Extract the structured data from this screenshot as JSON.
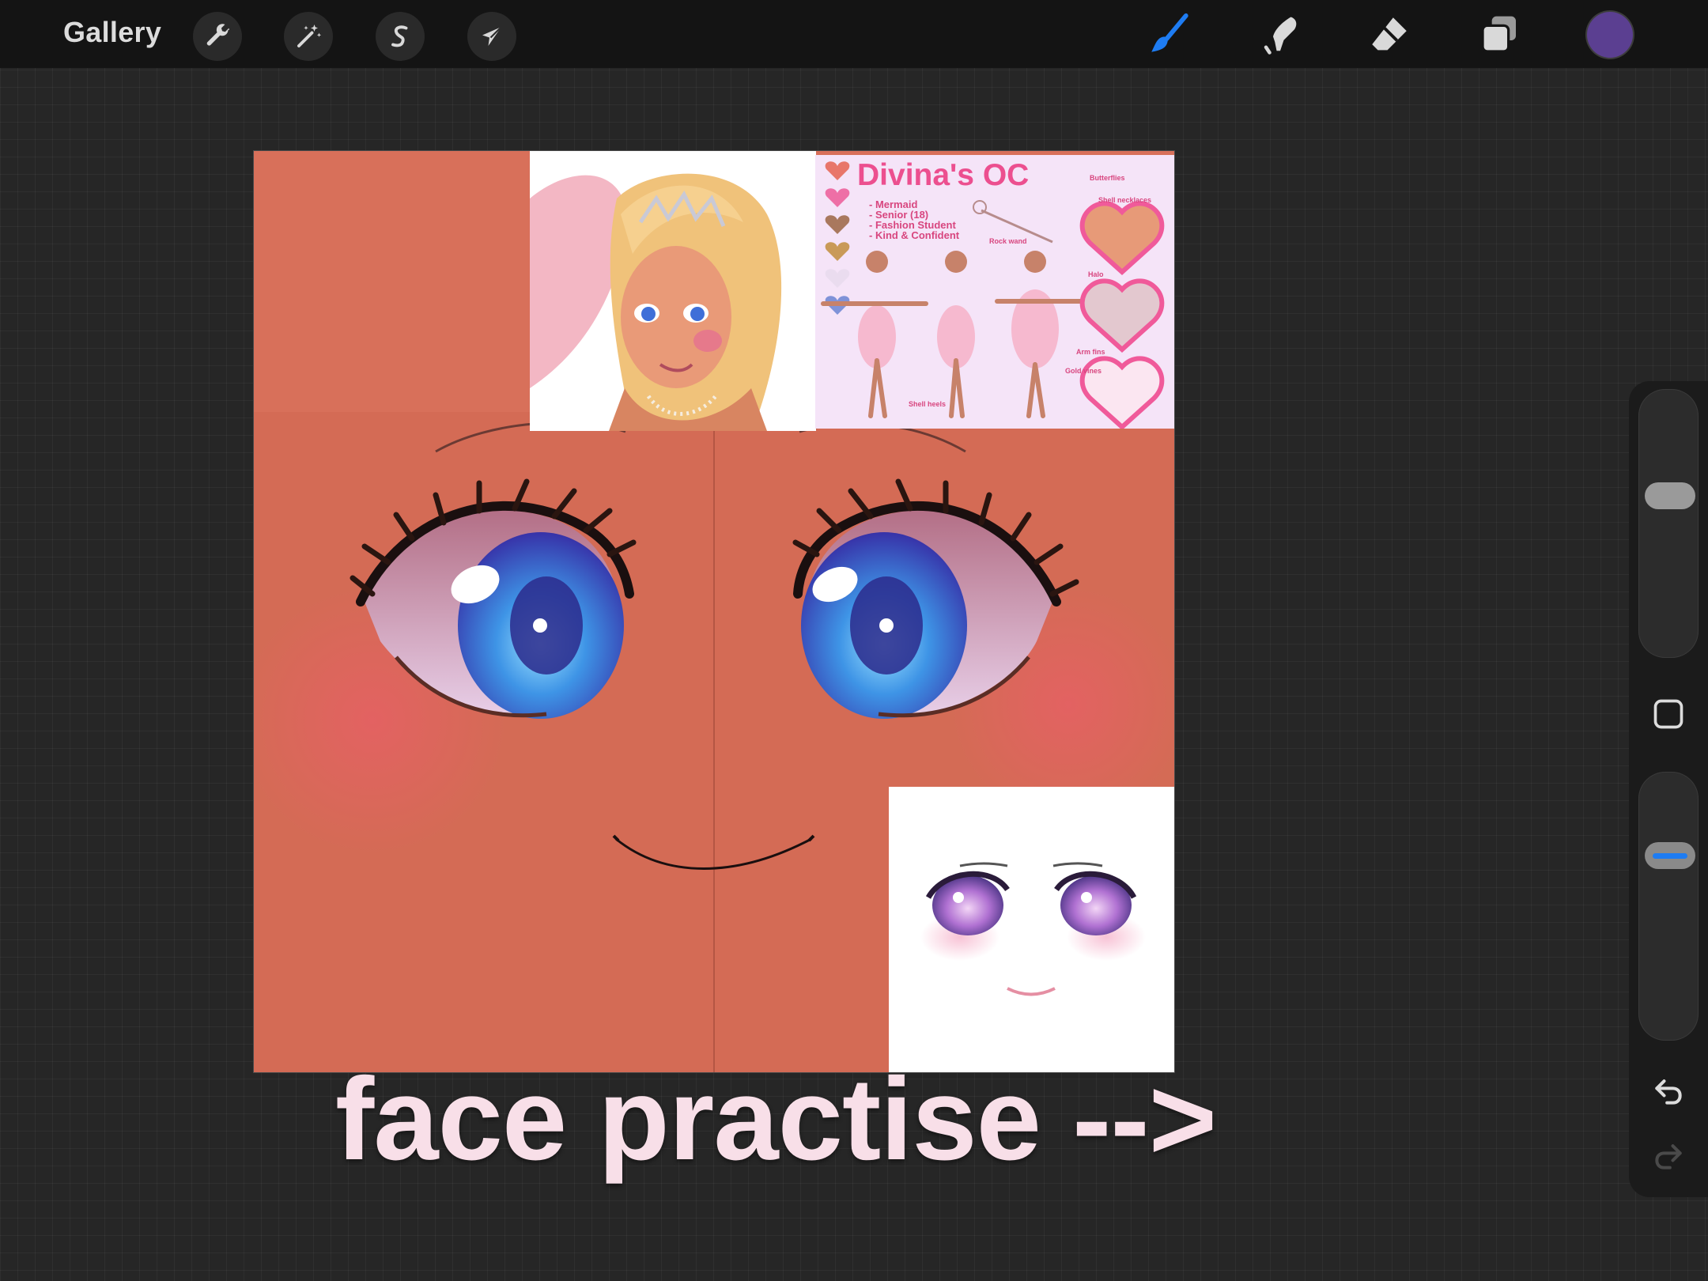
{
  "app": {
    "gallery_label": "Gallery",
    "accent_color": "#1e7cf2",
    "current_color": "#5b3f91"
  },
  "toolbar_left": [
    {
      "name": "actions",
      "icon": "wrench-icon"
    },
    {
      "name": "adjustments",
      "icon": "magic-wand-icon"
    },
    {
      "name": "selection",
      "icon": "selection-s-icon"
    },
    {
      "name": "transform",
      "icon": "arrow-cursor-icon"
    }
  ],
  "toolbar_right": [
    {
      "name": "brush",
      "icon": "brush-icon",
      "active": true
    },
    {
      "name": "smudge",
      "icon": "smudge-finger-icon",
      "active": false
    },
    {
      "name": "eraser",
      "icon": "eraser-icon",
      "active": false
    },
    {
      "name": "layers",
      "icon": "layers-icon",
      "active": false
    }
  ],
  "reference_sheet": {
    "title": "Divina's OC",
    "traits": [
      "- Mermaid",
      "- Senior (18)",
      "- Fashion Student",
      "- Kind & Confident"
    ],
    "notes": [
      "Butterflies",
      "Shell necklaces",
      "Rock wand",
      "Halo",
      "Arm fins",
      "Gold vines",
      "Shell heels"
    ]
  },
  "caption": "face practise -->",
  "sidebar": {
    "brush_size": 0.62,
    "brush_opacity": 0.72,
    "modify_icon": "square-modify-icon",
    "undo_icon": "undo-icon",
    "redo_icon": "redo-icon"
  }
}
